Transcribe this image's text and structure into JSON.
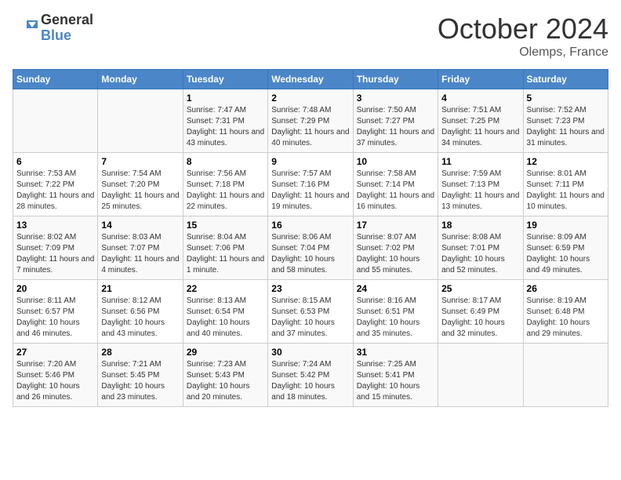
{
  "header": {
    "logo_line1": "General",
    "logo_line2": "Blue",
    "month": "October 2024",
    "location": "Olemps, France"
  },
  "weekdays": [
    "Sunday",
    "Monday",
    "Tuesday",
    "Wednesday",
    "Thursday",
    "Friday",
    "Saturday"
  ],
  "weeks": [
    [
      {
        "day": "",
        "info": ""
      },
      {
        "day": "",
        "info": ""
      },
      {
        "day": "1",
        "info": "Sunrise: 7:47 AM\nSunset: 7:31 PM\nDaylight: 11 hours and 43 minutes."
      },
      {
        "day": "2",
        "info": "Sunrise: 7:48 AM\nSunset: 7:29 PM\nDaylight: 11 hours and 40 minutes."
      },
      {
        "day": "3",
        "info": "Sunrise: 7:50 AM\nSunset: 7:27 PM\nDaylight: 11 hours and 37 minutes."
      },
      {
        "day": "4",
        "info": "Sunrise: 7:51 AM\nSunset: 7:25 PM\nDaylight: 11 hours and 34 minutes."
      },
      {
        "day": "5",
        "info": "Sunrise: 7:52 AM\nSunset: 7:23 PM\nDaylight: 11 hours and 31 minutes."
      }
    ],
    [
      {
        "day": "6",
        "info": "Sunrise: 7:53 AM\nSunset: 7:22 PM\nDaylight: 11 hours and 28 minutes."
      },
      {
        "day": "7",
        "info": "Sunrise: 7:54 AM\nSunset: 7:20 PM\nDaylight: 11 hours and 25 minutes."
      },
      {
        "day": "8",
        "info": "Sunrise: 7:56 AM\nSunset: 7:18 PM\nDaylight: 11 hours and 22 minutes."
      },
      {
        "day": "9",
        "info": "Sunrise: 7:57 AM\nSunset: 7:16 PM\nDaylight: 11 hours and 19 minutes."
      },
      {
        "day": "10",
        "info": "Sunrise: 7:58 AM\nSunset: 7:14 PM\nDaylight: 11 hours and 16 minutes."
      },
      {
        "day": "11",
        "info": "Sunrise: 7:59 AM\nSunset: 7:13 PM\nDaylight: 11 hours and 13 minutes."
      },
      {
        "day": "12",
        "info": "Sunrise: 8:01 AM\nSunset: 7:11 PM\nDaylight: 11 hours and 10 minutes."
      }
    ],
    [
      {
        "day": "13",
        "info": "Sunrise: 8:02 AM\nSunset: 7:09 PM\nDaylight: 11 hours and 7 minutes."
      },
      {
        "day": "14",
        "info": "Sunrise: 8:03 AM\nSunset: 7:07 PM\nDaylight: 11 hours and 4 minutes."
      },
      {
        "day": "15",
        "info": "Sunrise: 8:04 AM\nSunset: 7:06 PM\nDaylight: 11 hours and 1 minute."
      },
      {
        "day": "16",
        "info": "Sunrise: 8:06 AM\nSunset: 7:04 PM\nDaylight: 10 hours and 58 minutes."
      },
      {
        "day": "17",
        "info": "Sunrise: 8:07 AM\nSunset: 7:02 PM\nDaylight: 10 hours and 55 minutes."
      },
      {
        "day": "18",
        "info": "Sunrise: 8:08 AM\nSunset: 7:01 PM\nDaylight: 10 hours and 52 minutes."
      },
      {
        "day": "19",
        "info": "Sunrise: 8:09 AM\nSunset: 6:59 PM\nDaylight: 10 hours and 49 minutes."
      }
    ],
    [
      {
        "day": "20",
        "info": "Sunrise: 8:11 AM\nSunset: 6:57 PM\nDaylight: 10 hours and 46 minutes."
      },
      {
        "day": "21",
        "info": "Sunrise: 8:12 AM\nSunset: 6:56 PM\nDaylight: 10 hours and 43 minutes."
      },
      {
        "day": "22",
        "info": "Sunrise: 8:13 AM\nSunset: 6:54 PM\nDaylight: 10 hours and 40 minutes."
      },
      {
        "day": "23",
        "info": "Sunrise: 8:15 AM\nSunset: 6:53 PM\nDaylight: 10 hours and 37 minutes."
      },
      {
        "day": "24",
        "info": "Sunrise: 8:16 AM\nSunset: 6:51 PM\nDaylight: 10 hours and 35 minutes."
      },
      {
        "day": "25",
        "info": "Sunrise: 8:17 AM\nSunset: 6:49 PM\nDaylight: 10 hours and 32 minutes."
      },
      {
        "day": "26",
        "info": "Sunrise: 8:19 AM\nSunset: 6:48 PM\nDaylight: 10 hours and 29 minutes."
      }
    ],
    [
      {
        "day": "27",
        "info": "Sunrise: 7:20 AM\nSunset: 5:46 PM\nDaylight: 10 hours and 26 minutes."
      },
      {
        "day": "28",
        "info": "Sunrise: 7:21 AM\nSunset: 5:45 PM\nDaylight: 10 hours and 23 minutes."
      },
      {
        "day": "29",
        "info": "Sunrise: 7:23 AM\nSunset: 5:43 PM\nDaylight: 10 hours and 20 minutes."
      },
      {
        "day": "30",
        "info": "Sunrise: 7:24 AM\nSunset: 5:42 PM\nDaylight: 10 hours and 18 minutes."
      },
      {
        "day": "31",
        "info": "Sunrise: 7:25 AM\nSunset: 5:41 PM\nDaylight: 10 hours and 15 minutes."
      },
      {
        "day": "",
        "info": ""
      },
      {
        "day": "",
        "info": ""
      }
    ]
  ]
}
